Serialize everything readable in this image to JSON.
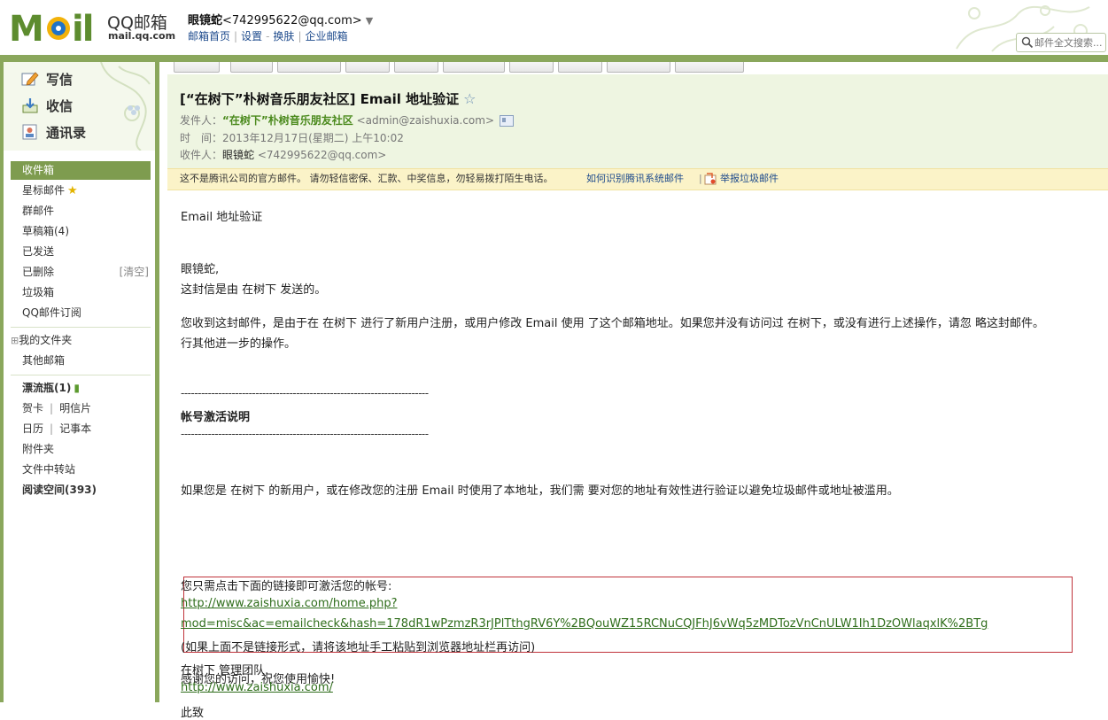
{
  "header": {
    "logo_text": "MOil",
    "brand": "QQ邮箱",
    "brand_url": "mail.qq.com",
    "user_name": "眼镜蛇",
    "user_email": "<742995622@qq.com>",
    "links": [
      "邮箱首页",
      "设置",
      "换肤",
      "企业邮箱"
    ],
    "search_placeholder": "邮件全文搜索..."
  },
  "sidebar": {
    "write": "写信",
    "receive": "收信",
    "contacts": "通讯录",
    "folders": {
      "inbox": "收件箱",
      "starred": "星标邮件",
      "group": "群邮件",
      "drafts": "草稿箱(4)",
      "sent": "已发送",
      "deleted": "已删除",
      "deleted_clear": "[清空]",
      "spam": "垃圾箱",
      "subscription": "QQ邮件订阅",
      "my_folders": "我的文件夹",
      "other_mail": "其他邮箱",
      "drift_bottle": "漂流瓶(1)",
      "card": "贺卡",
      "postcard": "明信片",
      "calendar": "日历",
      "notes": "记事本",
      "attachments": "附件夹",
      "file_transfer": "文件中转站",
      "reading_space": "阅读空间(393)"
    }
  },
  "mail": {
    "subject": "[“在树下”朴树音乐朋友社区] Email 地址验证",
    "from_label": "发件人：",
    "from_name": "“在树下”朴树音乐朋友社区",
    "from_email": "<admin@zaishuxia.com>",
    "time_label": "时　间：",
    "time_value": "2013年12月17日(星期二) 上午10:02",
    "to_label": "收件人：",
    "to_name": "眼镜蛇",
    "to_email": "<742995622@qq.com>",
    "warning": "这不是腾讯公司的官方邮件。 请勿轻信密保、汇款、中奖信息，勿轻易拨打陌生电话。",
    "warning_link": "如何识别腾讯系统邮件",
    "report": "举报垃圾邮件",
    "body": {
      "title": "Email 地址验证",
      "greeting": "眼镜蛇,",
      "line1": "这封信是由 在树下 发送的。",
      "para1a": "您收到这封邮件，是由于在 在树下 进行了新用户注册，或用户修改 Email 使用 了这个邮箱地址。如果您并没有访问过 在树下，或没有进行上述操作，请忽 略这封邮件。",
      "para1b": "行其他进一步的操作。",
      "dashes": "-------------------------------------------------------------------------",
      "section": "帐号激活说明",
      "para2": "如果您是 在树下 的新用户，或在修改您的注册 Email 时使用了本地址，我们需 要对您的地址有效性进行验证以避免垃圾邮件或地址被滥用。",
      "click_hint": "您只需点击下面的链接即可激活您的帐号:",
      "link1": "http://www.zaishuxia.com/home.php?",
      "link2": "mod=misc&ac=emailcheck&hash=178dR1wPzmzR3rJPlTthgRV6Y%2BQouWZ15RCNuCQJFhJ6vWq5zMDTozVnCnULW1Ih1DzOWlaqxlK%2BTg",
      "copy_hint": "(如果上面不是链接形式，请将该地址手工粘贴到浏览器地址栏再访问)",
      "thanks": "感谢您的访问，祝您使用愉快!",
      "regards": "此致",
      "team": "在树下 管理团队.",
      "site": "http://www.zaishuxia.com/"
    }
  }
}
